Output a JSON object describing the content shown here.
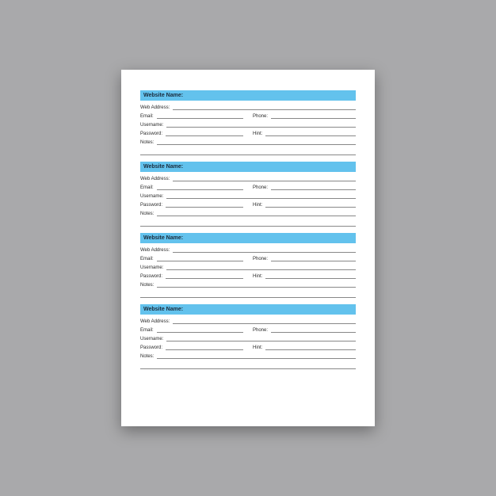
{
  "accent_color": "#63c2ed",
  "entries": [
    {
      "header": "Website Name:",
      "web_address": "Web Address:",
      "email": "Email:",
      "phone": "Phone:",
      "username": "Username:",
      "password": "Password:",
      "hint": "Hint:",
      "notes": "Notes:"
    },
    {
      "header": "Website Name:",
      "web_address": "Web Address:",
      "email": "Email:",
      "phone": "Phone:",
      "username": "Username:",
      "password": "Password:",
      "hint": "Hint:",
      "notes": "Notes:"
    },
    {
      "header": "Website Name:",
      "web_address": "Web Address:",
      "email": "Email:",
      "phone": "Phone:",
      "username": "Username:",
      "password": "Password:",
      "hint": "Hint:",
      "notes": "Notes:"
    },
    {
      "header": "Website Name:",
      "web_address": "Web Address:",
      "email": "Email:",
      "phone": "Phone:",
      "username": "Username:",
      "password": "Password:",
      "hint": "Hint:",
      "notes": "Notes:"
    }
  ]
}
